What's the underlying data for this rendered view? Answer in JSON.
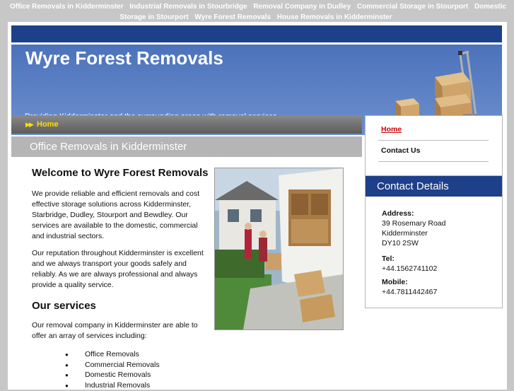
{
  "top_links": [
    "Office Removals in Kidderminster",
    "Industrial Removals in Stourbridge",
    "Removal Company in Dudley",
    "Commercial Storage in Stourport",
    "Domestic Storage in Stourport",
    "Wyre Forest Removals",
    "House Removals in Kidderminster"
  ],
  "banner": {
    "title": "Wyre Forest Removals",
    "tagline": "Providing Kidderminster and the surrounding areas with removal services."
  },
  "breadcrumb": {
    "home": "Home"
  },
  "page_title": "Office Removals in Kidderminster",
  "content": {
    "welcome_heading": "Welcome to Wyre Forest Removals",
    "para1": "We provide reliable and efficient removals and cost effective storage solutions across Kidderminster, Starbridge, Dudley, Stourport and Bewdley. Our services are available to the domestic, commercial and industrial sectors.",
    "para2": "Our reputation throughout Kidderminster is excellent and we always transport your goods safely and reliably. As we are always professional and always provide a quality service.",
    "services_heading": "Our services",
    "services_intro": "Our removal company in Kidderminster are able to offer an array of services including:",
    "services": [
      "Office Removals",
      "Commercial Removals",
      "Domestic Removals",
      "Industrial Removals"
    ]
  },
  "sidenav": {
    "home": "Home",
    "contact": "Contact Us"
  },
  "contact": {
    "heading": "Contact Details",
    "address_label": "Address:",
    "address": [
      "39 Rosemary Road",
      "Kidderminster",
      "DY10 2SW"
    ],
    "tel_label": "Tel:",
    "tel": "+44.1562741102",
    "mobile_label": "Mobile:",
    "mobile": "+44.7811442467"
  },
  "colors": {
    "accent_navy": "#1e3f8a",
    "banner_blue": "#4b72bb",
    "home_yellow": "#ffde00",
    "link_red": "#cc0000"
  }
}
